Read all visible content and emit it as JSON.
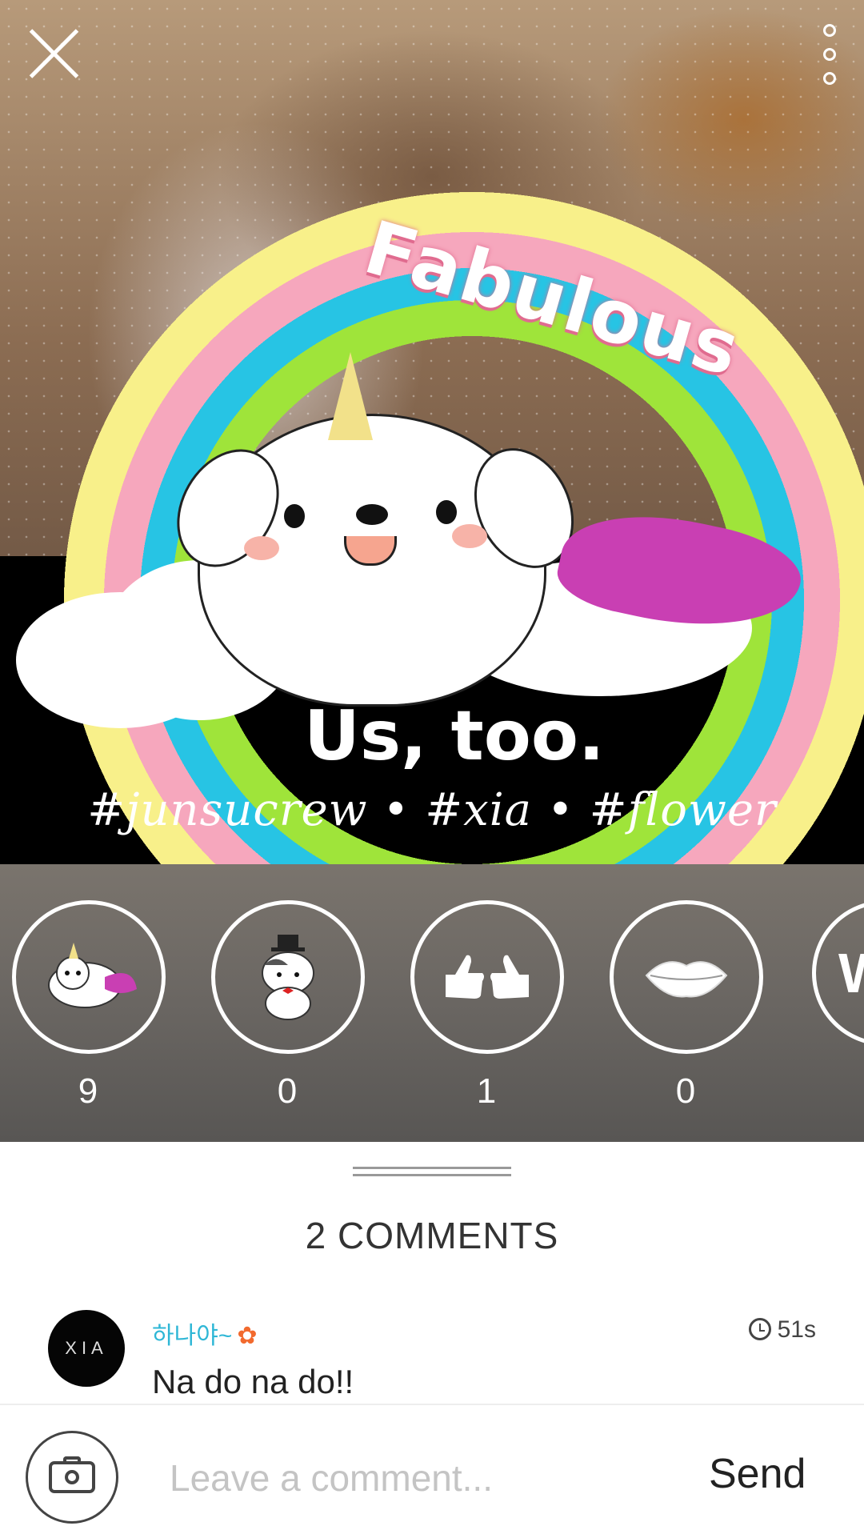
{
  "post": {
    "sticker_title": "Fabulous",
    "caption": "Us, too.",
    "hashtags": "#junsucrew  •  #xia  •  #flower"
  },
  "top_bar": {
    "close_icon": "close-icon",
    "more_icon": "more-vertical-icon"
  },
  "reactions": [
    {
      "name": "unicorn-dog-sticker",
      "count": "9"
    },
    {
      "name": "cat-gentleman-sticker",
      "count": "0"
    },
    {
      "name": "double-thumbs-up-sticker",
      "count": "1"
    },
    {
      "name": "lips-sticker",
      "count": "0"
    },
    {
      "name": "partial-sticker",
      "glyph": "W"
    }
  ],
  "comments": {
    "title": "2 COMMENTS",
    "items": [
      {
        "avatar_text": "XIA",
        "user": "하나야~",
        "user_emoji": "✿",
        "time": "51s",
        "text": "Na do na do!!"
      }
    ]
  },
  "input_bar": {
    "placeholder": "Leave a comment...",
    "send_label": "Send"
  },
  "colors": {
    "username": "#2fb7d6",
    "reaction_strip": "#6a6662"
  }
}
